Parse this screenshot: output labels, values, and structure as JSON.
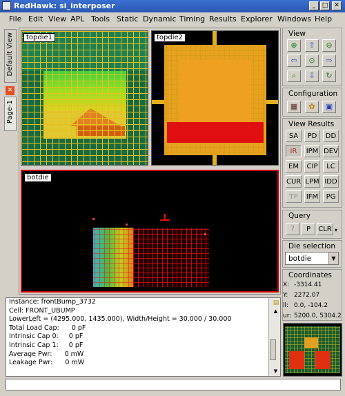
{
  "window": {
    "title": "RedHawk: si_interposer"
  },
  "menu": [
    "File",
    "Edit",
    "View",
    "APL",
    "Tools",
    "Static",
    "Dynamic",
    "Timing",
    "Results",
    "Explorer",
    "Windows",
    "Help"
  ],
  "left_tabs": {
    "default_view": "Default View",
    "page1": "Page-1"
  },
  "panels": {
    "topdie1": "topdie1",
    "topdie2": "topdie2",
    "botdie": "botdie"
  },
  "view_group": {
    "title": "View"
  },
  "configuration_group": {
    "title": "Configuration"
  },
  "view_results": {
    "title": "View Results",
    "buttons": [
      [
        "SA",
        "PD",
        "DD"
      ],
      [
        "IR",
        "IPM",
        "DEV"
      ],
      [
        "EM",
        "CIP",
        "LC"
      ],
      [
        "CUR",
        "LPM",
        "IDD"
      ],
      [
        "TP",
        "IFM",
        "PG"
      ]
    ]
  },
  "query": {
    "title": "Query",
    "p_label": "P",
    "clr_label": "CLR"
  },
  "die_selection": {
    "title": "Die selection",
    "value": "botdie"
  },
  "coordinates": {
    "title": "Coordinates",
    "x_label": "X:",
    "x_value": "-3314.41",
    "y_label": "Y:",
    "y_value": "2272.07",
    "ll_label": "ll:",
    "ll_value": "0.0, -104.2",
    "ur_label": "ur:",
    "ur_value": "5200.0, 5304.2"
  },
  "info_lines": [
    "Instance: frontBump_3732",
    "Cell: FRONT_UBUMP",
    "LowerLeft = (4295.000, 1435.000), Width/Height = 30.000 / 30.000",
    "Total Load Cap:      0 pF",
    "Intrinsic Cap 0:     0 pF",
    "Intrinsic Cap 1:     0 pF",
    "Average Pwr:      0 mW",
    "Leakage Pwr:      0 mW"
  ],
  "status": {
    "text": ""
  },
  "colors": {
    "title_bar": "#2a57b4",
    "grid_yellow": "#f0c000",
    "red_region": "#e00000",
    "selected_border": "#cc0000"
  }
}
